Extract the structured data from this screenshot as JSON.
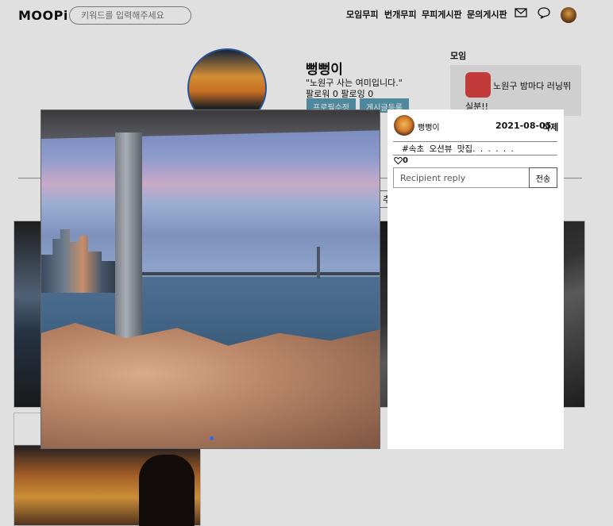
{
  "header": {
    "logo": "MOOPi",
    "search_placeholder": "키워드를 입력해주세요",
    "nav": [
      "모임무피",
      "번개무피",
      "무피게시판",
      "문의게시판"
    ]
  },
  "profile": {
    "name": "뻥뻥이",
    "bio": "\"노원구 사는 여미입니다.\"",
    "follow_text": "팔로워 0   팔로잉 0",
    "edit_button": "프로필수정",
    "post_button": "게시글등록"
  },
  "groups": {
    "title": "모임",
    "item_name": "노원구 밤마다 러닝뛰",
    "item_sub": "실분!!"
  },
  "tab_fragment": "추",
  "modal": {
    "username": "뻥뻥이",
    "date": "2021-08-05",
    "delete_label": "삭제",
    "tags": "#속초  오션뷰  맛집. . . . . .",
    "likes": "0",
    "reply_placeholder": "Recipient reply",
    "send_label": "전송"
  },
  "colors": {
    "accent_border": "#2d5fa8",
    "profile_button": "#5b9bb3",
    "carousel_dot": "#2e6be6"
  },
  "icons": [
    "mail-icon",
    "chat-icon",
    "heart-icon"
  ]
}
